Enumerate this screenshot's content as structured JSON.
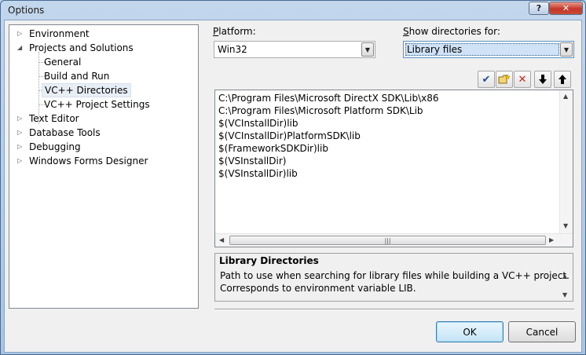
{
  "window": {
    "title": "Options",
    "help_label": "?",
    "close_label": "✕"
  },
  "tree": {
    "items": [
      {
        "label": "Environment",
        "arrow": "▷"
      },
      {
        "label": "Projects and Solutions",
        "arrow": "◢"
      },
      {
        "label": "General"
      },
      {
        "label": "Build and Run"
      },
      {
        "label": "VC++ Directories",
        "selected": true
      },
      {
        "label": "VC++ Project Settings"
      },
      {
        "label": "Text Editor",
        "arrow": "▷"
      },
      {
        "label": "Database Tools",
        "arrow": "▷"
      },
      {
        "label": "Debugging",
        "arrow": "▷"
      },
      {
        "label": "Windows Forms Designer",
        "arrow": "▷"
      }
    ]
  },
  "platform": {
    "label_first": "P",
    "label_rest": "latform:",
    "value": "Win32"
  },
  "show_dirs": {
    "label_first": "S",
    "label_rest": "how directories for:",
    "value": "Library files"
  },
  "toolbar": {
    "check_icon": "✔",
    "new_folder_icon": "▭",
    "delete_icon": "✕",
    "down_icon": "🡇",
    "up_icon": "🡅"
  },
  "directories": [
    "C:\\Program Files\\Microsoft DirectX SDK\\Lib\\x86",
    "C:\\Program Files\\Microsoft Platform SDK\\Lib",
    "$(VCInstallDir)lib",
    "$(VCInstallDir)PlatformSDK\\lib",
    "$(FrameworkSDKDir)lib",
    "$(VSInstallDir)",
    "$(VSInstallDir)lib"
  ],
  "description": {
    "title": "Library Directories",
    "line1": "Path to use when searching for library files while building a VC++ project.",
    "line2": "Corresponds to environment variable LIB."
  },
  "buttons": {
    "ok": "OK",
    "cancel": "Cancel"
  },
  "colors": {
    "accent": "#5692c4",
    "title_bar": "#b9d1ea",
    "close_red": "#c4372a"
  }
}
